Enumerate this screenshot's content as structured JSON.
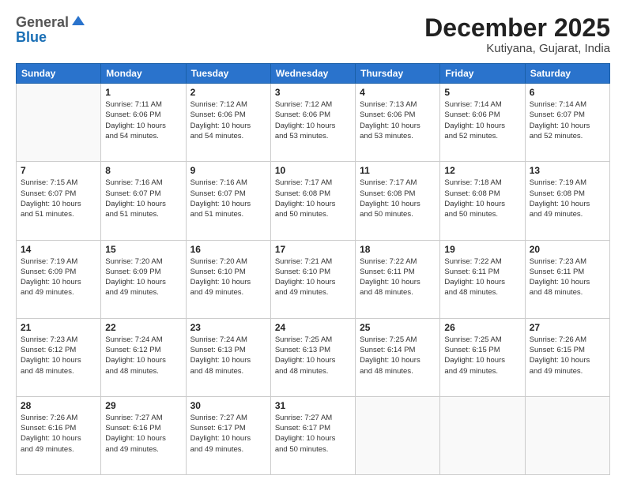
{
  "header": {
    "logo": {
      "line1": "General",
      "line2": "Blue"
    },
    "title": "December 2025",
    "location": "Kutiyana, Gujarat, India"
  },
  "weekdays": [
    "Sunday",
    "Monday",
    "Tuesday",
    "Wednesday",
    "Thursday",
    "Friday",
    "Saturday"
  ],
  "weeks": [
    [
      {
        "day": "",
        "info": ""
      },
      {
        "day": "1",
        "info": "Sunrise: 7:11 AM\nSunset: 6:06 PM\nDaylight: 10 hours\nand 54 minutes."
      },
      {
        "day": "2",
        "info": "Sunrise: 7:12 AM\nSunset: 6:06 PM\nDaylight: 10 hours\nand 54 minutes."
      },
      {
        "day": "3",
        "info": "Sunrise: 7:12 AM\nSunset: 6:06 PM\nDaylight: 10 hours\nand 53 minutes."
      },
      {
        "day": "4",
        "info": "Sunrise: 7:13 AM\nSunset: 6:06 PM\nDaylight: 10 hours\nand 53 minutes."
      },
      {
        "day": "5",
        "info": "Sunrise: 7:14 AM\nSunset: 6:06 PM\nDaylight: 10 hours\nand 52 minutes."
      },
      {
        "day": "6",
        "info": "Sunrise: 7:14 AM\nSunset: 6:07 PM\nDaylight: 10 hours\nand 52 minutes."
      }
    ],
    [
      {
        "day": "7",
        "info": "Sunrise: 7:15 AM\nSunset: 6:07 PM\nDaylight: 10 hours\nand 51 minutes."
      },
      {
        "day": "8",
        "info": "Sunrise: 7:16 AM\nSunset: 6:07 PM\nDaylight: 10 hours\nand 51 minutes."
      },
      {
        "day": "9",
        "info": "Sunrise: 7:16 AM\nSunset: 6:07 PM\nDaylight: 10 hours\nand 51 minutes."
      },
      {
        "day": "10",
        "info": "Sunrise: 7:17 AM\nSunset: 6:08 PM\nDaylight: 10 hours\nand 50 minutes."
      },
      {
        "day": "11",
        "info": "Sunrise: 7:17 AM\nSunset: 6:08 PM\nDaylight: 10 hours\nand 50 minutes."
      },
      {
        "day": "12",
        "info": "Sunrise: 7:18 AM\nSunset: 6:08 PM\nDaylight: 10 hours\nand 50 minutes."
      },
      {
        "day": "13",
        "info": "Sunrise: 7:19 AM\nSunset: 6:08 PM\nDaylight: 10 hours\nand 49 minutes."
      }
    ],
    [
      {
        "day": "14",
        "info": "Sunrise: 7:19 AM\nSunset: 6:09 PM\nDaylight: 10 hours\nand 49 minutes."
      },
      {
        "day": "15",
        "info": "Sunrise: 7:20 AM\nSunset: 6:09 PM\nDaylight: 10 hours\nand 49 minutes."
      },
      {
        "day": "16",
        "info": "Sunrise: 7:20 AM\nSunset: 6:10 PM\nDaylight: 10 hours\nand 49 minutes."
      },
      {
        "day": "17",
        "info": "Sunrise: 7:21 AM\nSunset: 6:10 PM\nDaylight: 10 hours\nand 49 minutes."
      },
      {
        "day": "18",
        "info": "Sunrise: 7:22 AM\nSunset: 6:11 PM\nDaylight: 10 hours\nand 48 minutes."
      },
      {
        "day": "19",
        "info": "Sunrise: 7:22 AM\nSunset: 6:11 PM\nDaylight: 10 hours\nand 48 minutes."
      },
      {
        "day": "20",
        "info": "Sunrise: 7:23 AM\nSunset: 6:11 PM\nDaylight: 10 hours\nand 48 minutes."
      }
    ],
    [
      {
        "day": "21",
        "info": "Sunrise: 7:23 AM\nSunset: 6:12 PM\nDaylight: 10 hours\nand 48 minutes."
      },
      {
        "day": "22",
        "info": "Sunrise: 7:24 AM\nSunset: 6:12 PM\nDaylight: 10 hours\nand 48 minutes."
      },
      {
        "day": "23",
        "info": "Sunrise: 7:24 AM\nSunset: 6:13 PM\nDaylight: 10 hours\nand 48 minutes."
      },
      {
        "day": "24",
        "info": "Sunrise: 7:25 AM\nSunset: 6:13 PM\nDaylight: 10 hours\nand 48 minutes."
      },
      {
        "day": "25",
        "info": "Sunrise: 7:25 AM\nSunset: 6:14 PM\nDaylight: 10 hours\nand 48 minutes."
      },
      {
        "day": "26",
        "info": "Sunrise: 7:25 AM\nSunset: 6:15 PM\nDaylight: 10 hours\nand 49 minutes."
      },
      {
        "day": "27",
        "info": "Sunrise: 7:26 AM\nSunset: 6:15 PM\nDaylight: 10 hours\nand 49 minutes."
      }
    ],
    [
      {
        "day": "28",
        "info": "Sunrise: 7:26 AM\nSunset: 6:16 PM\nDaylight: 10 hours\nand 49 minutes."
      },
      {
        "day": "29",
        "info": "Sunrise: 7:27 AM\nSunset: 6:16 PM\nDaylight: 10 hours\nand 49 minutes."
      },
      {
        "day": "30",
        "info": "Sunrise: 7:27 AM\nSunset: 6:17 PM\nDaylight: 10 hours\nand 49 minutes."
      },
      {
        "day": "31",
        "info": "Sunrise: 7:27 AM\nSunset: 6:17 PM\nDaylight: 10 hours\nand 50 minutes."
      },
      {
        "day": "",
        "info": ""
      },
      {
        "day": "",
        "info": ""
      },
      {
        "day": "",
        "info": ""
      }
    ]
  ]
}
